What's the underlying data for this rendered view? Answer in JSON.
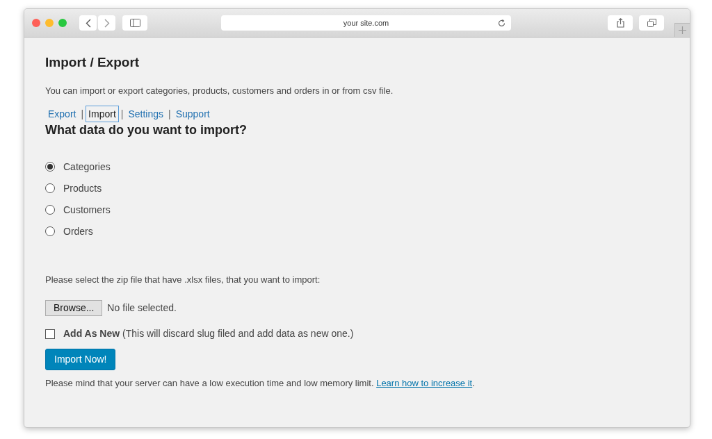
{
  "browser": {
    "url": "your site.com"
  },
  "page": {
    "title": "Import / Export",
    "intro": "You can import or export categories, products, customers and orders in or from csv file.",
    "nav_separator": "|",
    "nav": [
      {
        "label": "Export",
        "selected": false
      },
      {
        "label": "Import",
        "selected": true
      },
      {
        "label": "Settings",
        "selected": false
      },
      {
        "label": "Support",
        "selected": false
      }
    ],
    "question": "What data do you want to import?",
    "options": [
      {
        "label": "Categories",
        "selected": true
      },
      {
        "label": "Products",
        "selected": false
      },
      {
        "label": "Customers",
        "selected": false
      },
      {
        "label": "Orders",
        "selected": false
      }
    ],
    "file_prompt": "Please select the zip file that have .xlsx files, that you want to import:",
    "browse_button": "Browse...",
    "file_status": "No file selected.",
    "add_as_new": {
      "label": "**Add As New** (This will discard slug filed and add data as new one.)",
      "checked": false
    },
    "submit": "Import Now!",
    "note": "Please mind that your server can have a low execution time and low memory limit. ",
    "note_link": "Learn how to increase it",
    "note_end": "."
  }
}
